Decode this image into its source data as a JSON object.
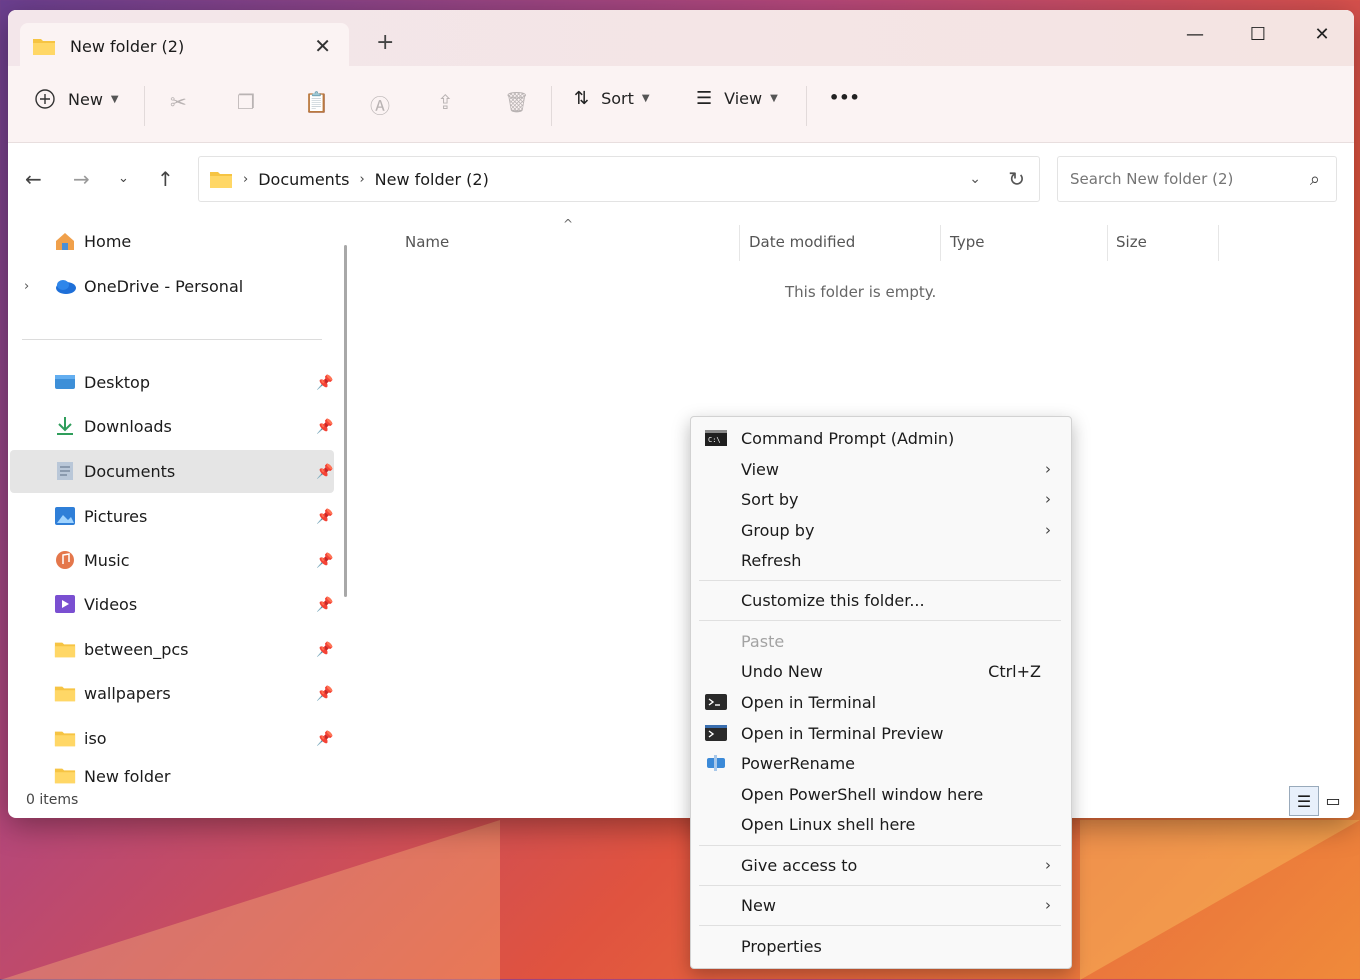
{
  "tab": {
    "title": "New folder (2)",
    "close": "✕",
    "new_tab": "+"
  },
  "window_controls": {
    "minimize": "—",
    "maximize": "☐",
    "close": "✕"
  },
  "toolbar": {
    "new_label": "New",
    "sort_label": "Sort",
    "view_label": "View",
    "more_label": "•••",
    "icons": [
      "cut-icon",
      "copy-icon",
      "paste-icon",
      "rename-icon",
      "share-icon",
      "delete-icon"
    ]
  },
  "address": {
    "breadcrumbs": [
      "Documents",
      "New folder (2)"
    ],
    "search_placeholder": "Search New folder (2)"
  },
  "sidebar": {
    "top_items": [
      {
        "label": "Home",
        "icon": "home-icon"
      },
      {
        "label": "OneDrive - Personal",
        "icon": "onedrive-icon"
      }
    ],
    "pinned_items": [
      {
        "label": "Desktop",
        "icon": "desktop-icon"
      },
      {
        "label": "Downloads",
        "icon": "downloads-icon"
      },
      {
        "label": "Documents",
        "icon": "documents-icon",
        "selected": true
      },
      {
        "label": "Pictures",
        "icon": "pictures-icon"
      },
      {
        "label": "Music",
        "icon": "music-icon"
      },
      {
        "label": "Videos",
        "icon": "videos-icon"
      },
      {
        "label": "between_pcs",
        "icon": "folder-icon"
      },
      {
        "label": "wallpapers",
        "icon": "folder-icon"
      },
      {
        "label": "iso",
        "icon": "folder-icon"
      },
      {
        "label": "New folder",
        "icon": "folder-icon"
      }
    ]
  },
  "columns": [
    "Name",
    "Date modified",
    "Type",
    "Size"
  ],
  "empty_message": "This folder is empty.",
  "status": {
    "items": "0 items"
  },
  "context_menu": {
    "items": [
      {
        "label": "Command Prompt (Admin)",
        "icon": "cmd-icon"
      },
      {
        "label": "View",
        "submenu": true
      },
      {
        "label": "Sort by",
        "submenu": true
      },
      {
        "label": "Group by",
        "submenu": true
      },
      {
        "label": "Refresh"
      },
      {
        "label": "Customize this folder..."
      },
      {
        "label": "Paste",
        "disabled": true
      },
      {
        "label": "Undo New",
        "shortcut": "Ctrl+Z"
      },
      {
        "label": "Open in Terminal",
        "icon": "terminal-icon"
      },
      {
        "label": "Open in Terminal Preview",
        "icon": "terminal-preview-icon"
      },
      {
        "label": "PowerRename",
        "icon": "powerrename-icon"
      },
      {
        "label": "Open PowerShell window here"
      },
      {
        "label": "Open Linux shell here"
      },
      {
        "label": "Give access to",
        "submenu": true
      },
      {
        "label": "New",
        "submenu": true
      },
      {
        "label": "Properties"
      }
    ],
    "arrow": "›"
  },
  "colors": {
    "accent": "#0067c0",
    "folder_yellow": "#f6c443",
    "selection": "#e5e5e5"
  }
}
